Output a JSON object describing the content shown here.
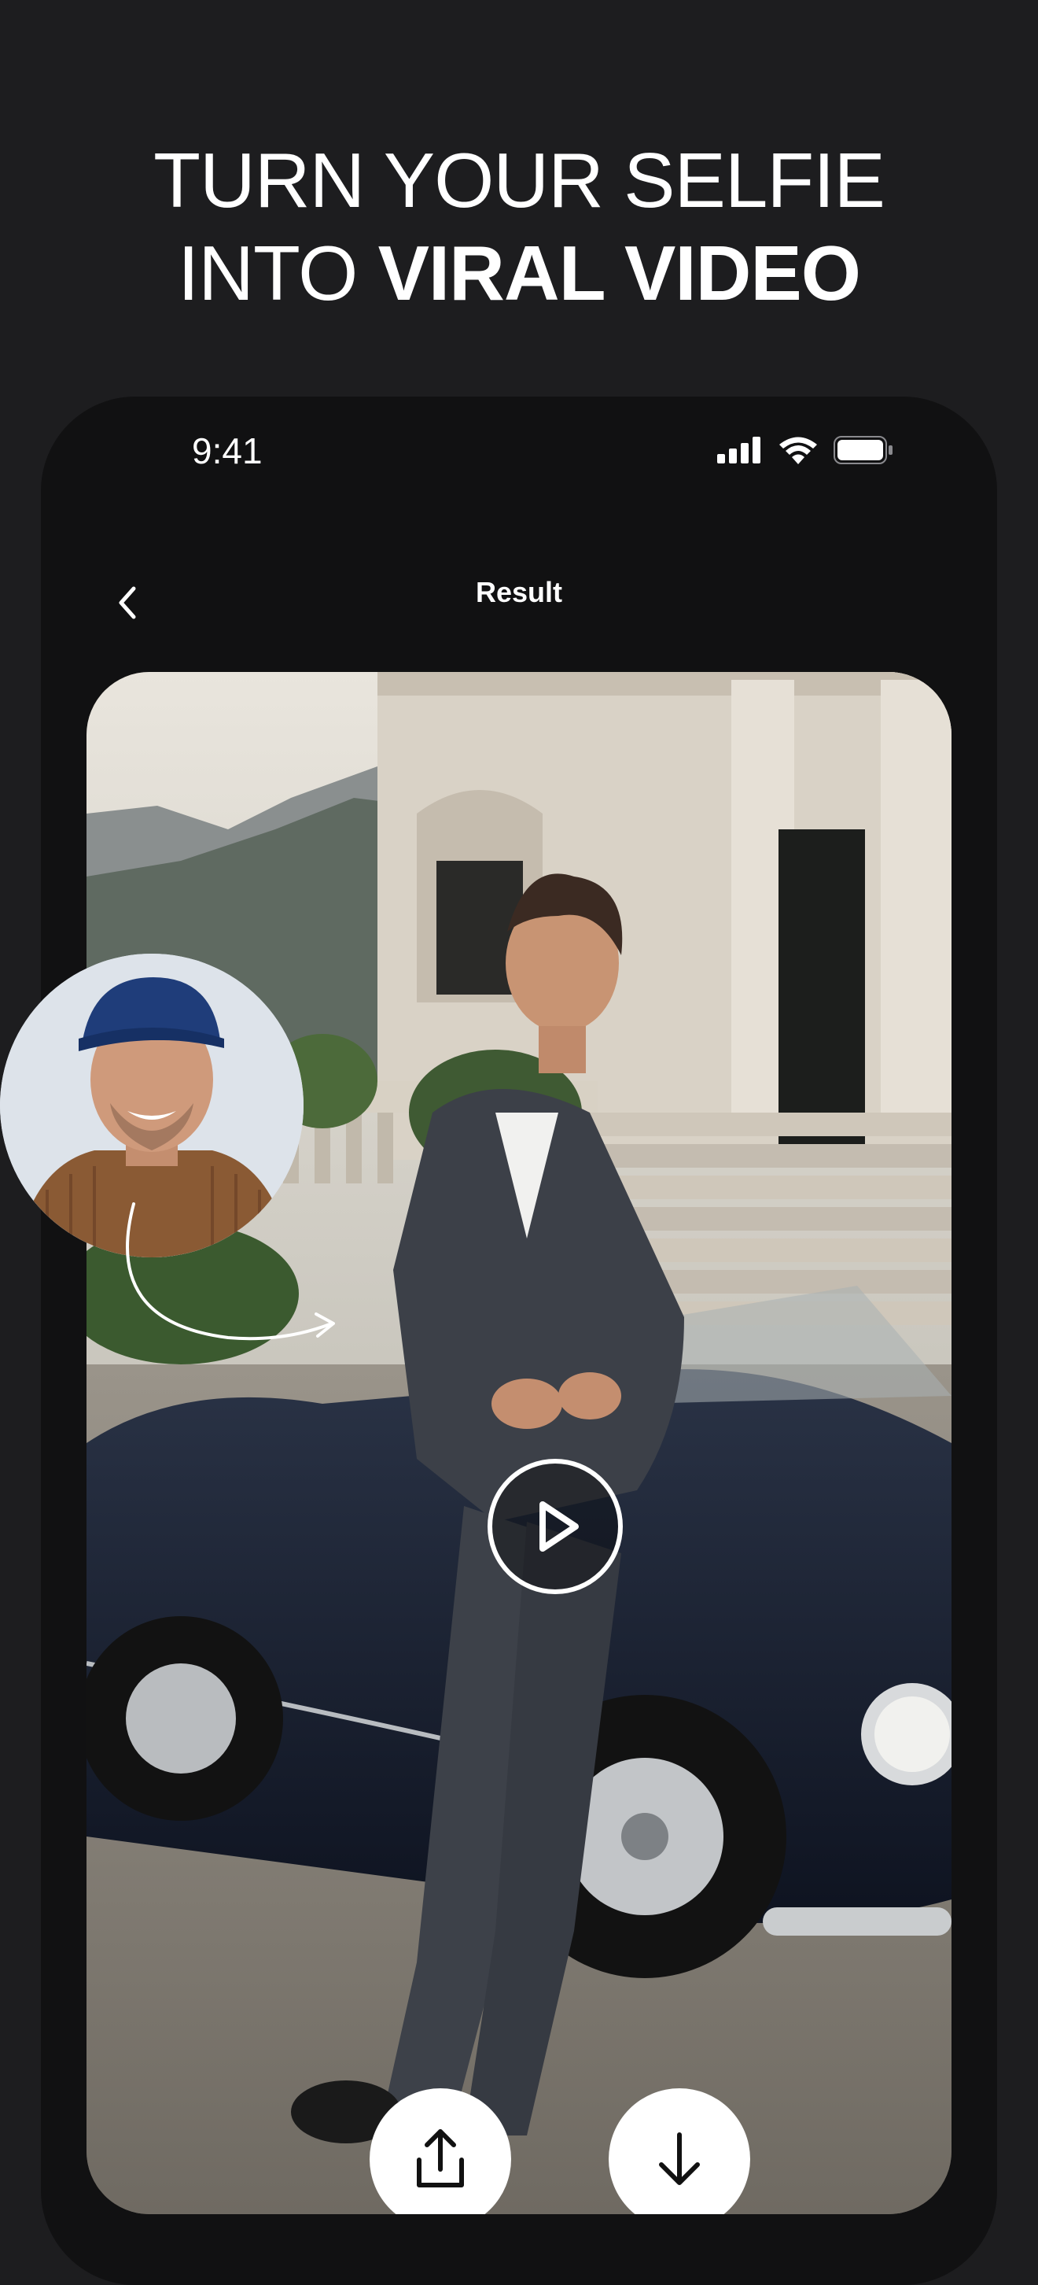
{
  "headline": {
    "line1": "TURN YOUR SELFIE",
    "line2_light": "INTO ",
    "line2_bold": "VIRAL VIDEO"
  },
  "status_bar": {
    "time": "9:41",
    "icons": [
      "signal-icon",
      "wifi-icon",
      "battery-icon"
    ]
  },
  "nav": {
    "back_icon": "chevron-left-icon",
    "title": "Result"
  },
  "media": {
    "play_icon": "play-icon",
    "actions": [
      {
        "name": "share",
        "icon": "share-icon"
      },
      {
        "name": "download",
        "icon": "download-icon"
      }
    ]
  },
  "selfie": {
    "icon": "arrow-curve-icon"
  },
  "colors": {
    "background": "#1d1d1f",
    "phone": "#111112",
    "text": "#ffffff"
  }
}
